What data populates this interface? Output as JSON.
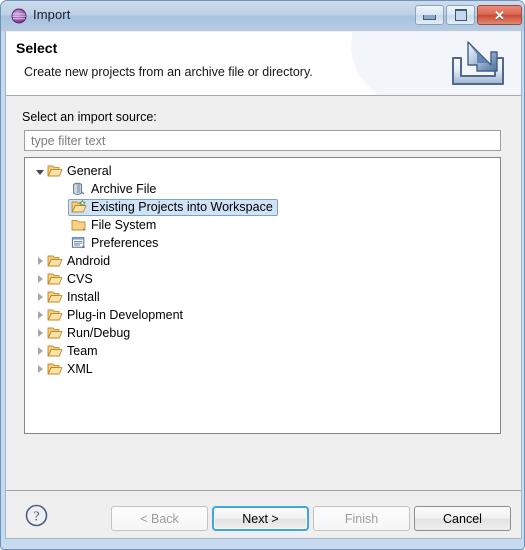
{
  "window": {
    "title": "Import",
    "icon": "eclipse-globe-icon",
    "controls": {
      "minimize": "minimize-icon",
      "maximize": "maximize-icon",
      "close": "close-icon"
    }
  },
  "header": {
    "title": "Select",
    "description": "Create new projects from an archive file or directory.",
    "icon": "import-arrow-icon"
  },
  "main": {
    "source_label": "Select an import source:",
    "filter": {
      "placeholder": "type filter text",
      "value": ""
    },
    "tree": [
      {
        "label": "General",
        "icon": "open-folder-icon",
        "indent": 0,
        "state": "expanded",
        "selected": false
      },
      {
        "label": "Archive File",
        "icon": "archive-file-icon",
        "indent": 1,
        "state": "leaf",
        "selected": false
      },
      {
        "label": "Existing Projects into Workspace",
        "icon": "existing-projects-icon",
        "indent": 1,
        "state": "leaf",
        "selected": true
      },
      {
        "label": "File System",
        "icon": "folder-icon",
        "indent": 1,
        "state": "leaf",
        "selected": false
      },
      {
        "label": "Preferences",
        "icon": "preferences-icon",
        "indent": 1,
        "state": "leaf",
        "selected": false
      },
      {
        "label": "Android",
        "icon": "open-folder-icon",
        "indent": 0,
        "state": "collapsed",
        "selected": false
      },
      {
        "label": "CVS",
        "icon": "open-folder-icon",
        "indent": 0,
        "state": "collapsed",
        "selected": false
      },
      {
        "label": "Install",
        "icon": "open-folder-icon",
        "indent": 0,
        "state": "collapsed",
        "selected": false
      },
      {
        "label": "Plug-in Development",
        "icon": "open-folder-icon",
        "indent": 0,
        "state": "collapsed",
        "selected": false
      },
      {
        "label": "Run/Debug",
        "icon": "open-folder-icon",
        "indent": 0,
        "state": "collapsed",
        "selected": false
      },
      {
        "label": "Team",
        "icon": "open-folder-icon",
        "indent": 0,
        "state": "collapsed",
        "selected": false
      },
      {
        "label": "XML",
        "icon": "open-folder-icon",
        "indent": 0,
        "state": "collapsed",
        "selected": false
      }
    ]
  },
  "footer": {
    "help_icon": "help-question-icon",
    "buttons": [
      {
        "label": "< Back",
        "state": "disabled"
      },
      {
        "label": "Next >",
        "state": "default"
      },
      {
        "label": "Finish",
        "state": "disabled"
      },
      {
        "label": "Cancel",
        "state": "normal"
      }
    ]
  },
  "colors": {
    "titlebar": "#b7cbe3",
    "dialog_bg": "#efefef",
    "selection_bg": "#cfe3f7",
    "selection_border": "#7da2c8",
    "focus_ring": "#3ba7e8",
    "close_button": "#cb4b35",
    "folder": "#e8b44a"
  }
}
